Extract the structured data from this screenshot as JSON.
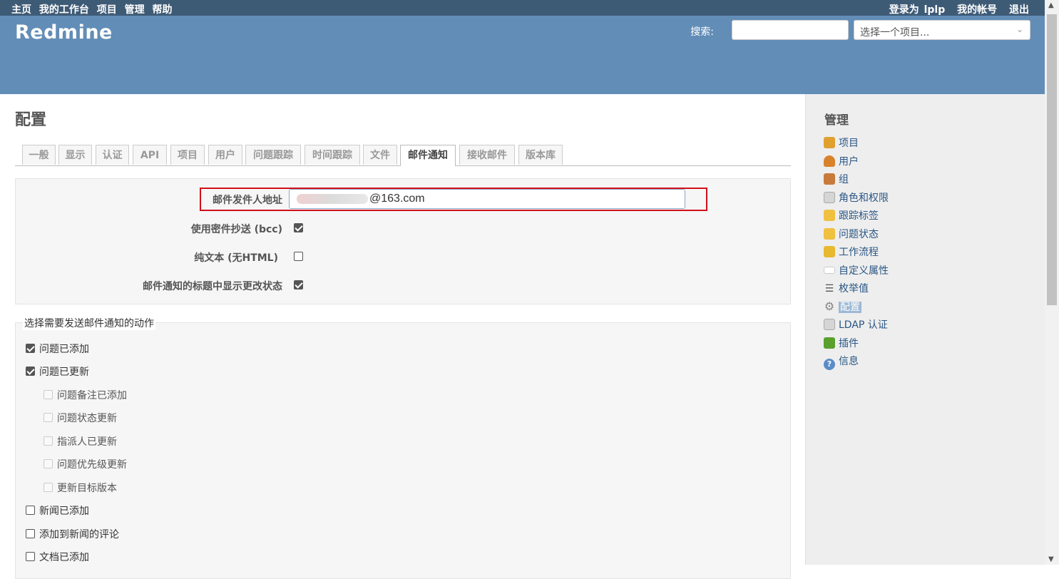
{
  "top_menu": {
    "left": [
      "主页",
      "我的工作台",
      "项目",
      "管理",
      "帮助"
    ],
    "logged_in_as": "登录为",
    "user": "lplp",
    "my_account": "我的帐号",
    "logout": "退出"
  },
  "header": {
    "title": "Redmine",
    "search_label": "搜索:",
    "search_value": "",
    "project_jump": "选择一个项目..."
  },
  "page": {
    "title": "配置",
    "tabs": [
      "一般",
      "显示",
      "认证",
      "API",
      "项目",
      "用户",
      "问题跟踪",
      "时间跟踪",
      "文件",
      "邮件通知",
      "接收邮件",
      "版本库"
    ],
    "selected_tab": "邮件通知"
  },
  "settings": {
    "emission_label": "邮件发件人地址",
    "emission_value": "@163.com",
    "bcc_label": "使用密件抄送 (bcc)",
    "bcc_checked": true,
    "plain_text_label": "纯文本 (无HTML)",
    "plain_text_checked": false,
    "status_subject_label": "邮件通知的标题中显示更改状态",
    "status_subject_checked": true
  },
  "actions": {
    "legend": "选择需要发送邮件通知的动作",
    "items": [
      {
        "label": "问题已添加",
        "checked": true,
        "indent": false
      },
      {
        "label": "问题已更新",
        "checked": true,
        "indent": false
      },
      {
        "label": "问题备注已添加",
        "checked": false,
        "indent": true
      },
      {
        "label": "问题状态更新",
        "checked": false,
        "indent": true
      },
      {
        "label": "指派人已更新",
        "checked": false,
        "indent": true
      },
      {
        "label": "问题优先级更新",
        "checked": false,
        "indent": true
      },
      {
        "label": "更新目标版本",
        "checked": false,
        "indent": true
      },
      {
        "label": "新闻已添加",
        "checked": false,
        "indent": false
      },
      {
        "label": "添加到新闻的评论",
        "checked": false,
        "indent": false
      },
      {
        "label": "文档已添加",
        "checked": false,
        "indent": false
      }
    ]
  },
  "sidebar": {
    "title": "管理",
    "items": [
      {
        "label": "项目",
        "icon": "projects-icon",
        "color": "#e0a030"
      },
      {
        "label": "用户",
        "icon": "user-icon",
        "color": "#d9822b"
      },
      {
        "label": "组",
        "icon": "group-icon",
        "color": "#c87a3a"
      },
      {
        "label": "角色和权限",
        "icon": "roles-icon",
        "color": "#c9c9c9"
      },
      {
        "label": "跟踪标签",
        "icon": "tracker-icon",
        "color": "#f0c040"
      },
      {
        "label": "问题状态",
        "icon": "issue-status-icon",
        "color": "#f0c040"
      },
      {
        "label": "工作流程",
        "icon": "workflow-icon",
        "color": "#e8b830"
      },
      {
        "label": "自定义属性",
        "icon": "custom-fields-icon",
        "color": "#ffffff"
      },
      {
        "label": "枚举值",
        "icon": "list-icon",
        "color": "#555555"
      },
      {
        "label": "配置",
        "icon": "settings-gear-icon",
        "color": "#888888",
        "selected": true
      },
      {
        "label": "LDAP 认证",
        "icon": "ldap-icon",
        "color": "#c9c9c9"
      },
      {
        "label": "插件",
        "icon": "plugin-icon",
        "color": "#5aa02c"
      },
      {
        "label": "信息",
        "icon": "info-icon",
        "color": "#5b8cc8"
      }
    ]
  }
}
